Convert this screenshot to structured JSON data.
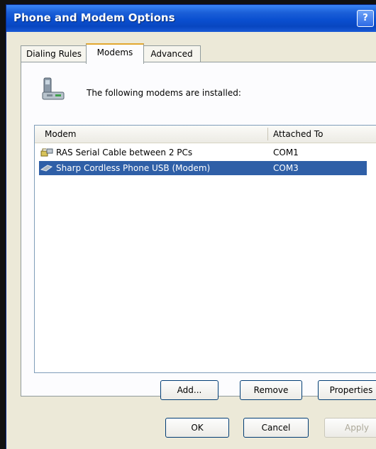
{
  "window": {
    "title": "Phone and Modem Options",
    "help_label": "?"
  },
  "tabs": [
    {
      "label": "Dialing Rules"
    },
    {
      "label": "Modems"
    },
    {
      "label": "Advanced"
    }
  ],
  "intro": "The following modems are installed:",
  "list": {
    "columns": [
      "Modem",
      "Attached To"
    ],
    "rows": [
      {
        "modem": "RAS Serial Cable between 2 PCs",
        "port": "COM1",
        "selected": false
      },
      {
        "modem": "Sharp Cordless Phone USB (Modem)",
        "port": "COM3",
        "selected": true
      }
    ]
  },
  "buttons": {
    "add": "Add...",
    "remove": "Remove",
    "properties": "Properties",
    "ok": "OK",
    "cancel": "Cancel",
    "apply": "Apply"
  },
  "colors": {
    "title_bar": "#0a4fd0",
    "selection": "#2f5fa7",
    "dialog_bg": "#ece9d8"
  }
}
